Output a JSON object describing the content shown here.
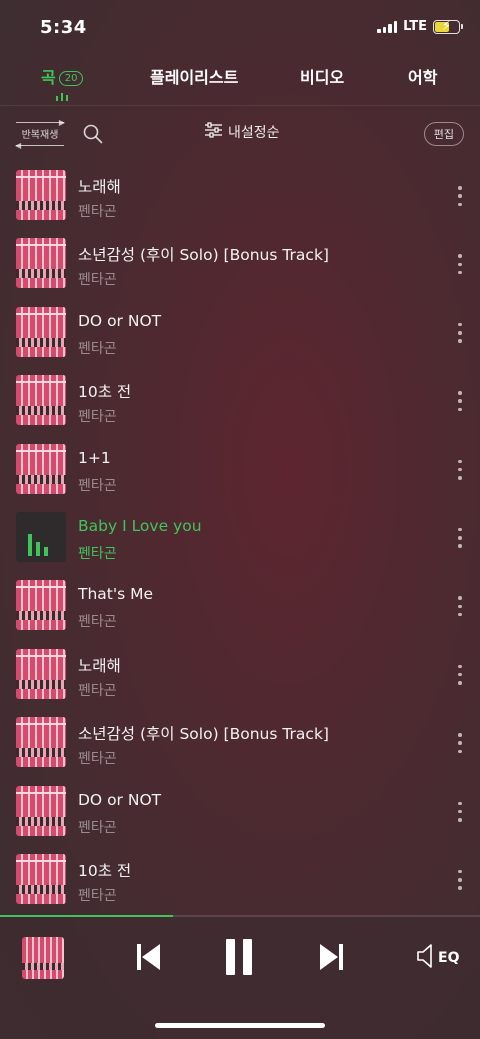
{
  "status_bar": {
    "time": "5:34",
    "network": "LTE",
    "battery_level": 0.6
  },
  "tabs": [
    {
      "label": "곡",
      "count": "20",
      "active": true
    },
    {
      "label": "플레이리스트",
      "active": false
    },
    {
      "label": "비디오",
      "active": false
    },
    {
      "label": "어학",
      "active": false
    }
  ],
  "toolbar": {
    "repeat_label": "반복재생",
    "sort_label": "내설정순",
    "edit_label": "편집"
  },
  "songs": [
    {
      "title": "노래해",
      "artist": "펜타곤",
      "playing": false
    },
    {
      "title": "소년감성 (후이 Solo) [Bonus Track]",
      "artist": "펜타곤",
      "playing": false
    },
    {
      "title": "DO or NOT",
      "artist": "펜타곤",
      "playing": false
    },
    {
      "title": "10초 전",
      "artist": "펜타곤",
      "playing": false
    },
    {
      "title": "1+1",
      "artist": "펜타곤",
      "playing": false
    },
    {
      "title": "Baby I Love you",
      "artist": "펜타곤",
      "playing": true
    },
    {
      "title": "That's Me",
      "artist": "펜타곤",
      "playing": false
    },
    {
      "title": "노래해",
      "artist": "펜타곤",
      "playing": false
    },
    {
      "title": "소년감성 (후이 Solo) [Bonus Track]",
      "artist": "펜타곤",
      "playing": false
    },
    {
      "title": "DO or NOT",
      "artist": "펜타곤",
      "playing": false
    },
    {
      "title": "10초 전",
      "artist": "펜타곤",
      "playing": false
    }
  ],
  "player": {
    "progress": 0.36,
    "eq_label": "EQ"
  },
  "colors": {
    "accent": "#3fc45a",
    "background": "#4b2a30",
    "text_secondary": "#a58f93"
  },
  "icons": [
    "search-icon",
    "sort-sliders-icon",
    "more-vertical-icon",
    "previous-track-icon",
    "pause-icon",
    "next-track-icon",
    "speaker-icon"
  ]
}
